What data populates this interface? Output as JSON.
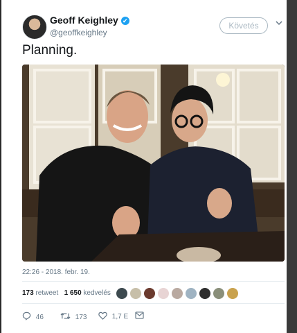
{
  "author": {
    "name": "Geoff Keighley",
    "handle": "@geoffkeighley",
    "verified_mark": "✔"
  },
  "follow_button": "Követés",
  "menu_chevron": "⌄",
  "tweet": {
    "text": "Planning.",
    "timestamp": "22:26 - 2018. febr. 19."
  },
  "stats": {
    "retweets_count": "173",
    "retweets_label": "retweet",
    "likes_count": "1 650",
    "likes_label": "kedvelés"
  },
  "actions": {
    "replies": "46",
    "retweets": "173",
    "likes": "1,7 E"
  },
  "icons": {
    "reply": "reply-icon",
    "retweet": "retweet-icon",
    "like": "heart-icon",
    "message": "direct-message-icon",
    "verified": "verified-badge-icon"
  },
  "colors": {
    "verified": "#1da1f2",
    "text": "#14171a",
    "secondary": "#657786"
  }
}
